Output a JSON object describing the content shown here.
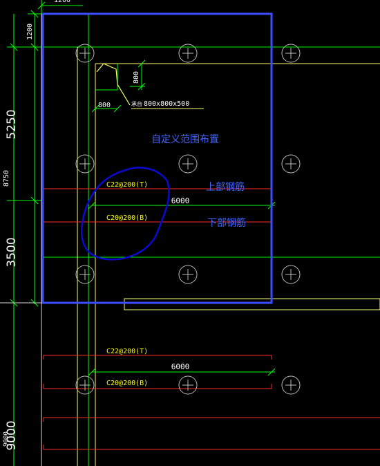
{
  "colors": {
    "background": "#000000",
    "dimension_green": "#00ff00",
    "axis_white": "#d8d8d8",
    "beam_yellow": "#ffff66",
    "rebar_red": "#ff2a2a",
    "selection_blue": "#3b4bff",
    "annotation_blue": "#4466ff",
    "markup_navy": "#0a0ad0",
    "label_yellow": "#ffff00",
    "text_white": "#ffffff"
  },
  "dimensions": {
    "left_1200": "1200",
    "left_5250": "5250",
    "left_8750": "8750",
    "left_3500": "3500",
    "left_9000_large": "9000",
    "left_9000_small": "9000",
    "top_cut": "1200"
  },
  "pile_cap": {
    "dim_vertical": "800",
    "dim_horizontal": "800",
    "tag": "承台",
    "size_label": "800x800x500"
  },
  "annotations": {
    "custom_range": "自定义范围布置",
    "top_rebar": "上部钢筋",
    "bottom_rebar": "下部钢筋"
  },
  "rebar_upper": {
    "top_label": "C22@200(T)",
    "bottom_label": "C20@200(B)",
    "span": "6000"
  },
  "rebar_lower": {
    "top_label": "C22@200(T)",
    "bottom_label": "C20@200(B)",
    "span": "6000"
  },
  "icons": {
    "grid_marker": "crosshair-circle-icon"
  }
}
